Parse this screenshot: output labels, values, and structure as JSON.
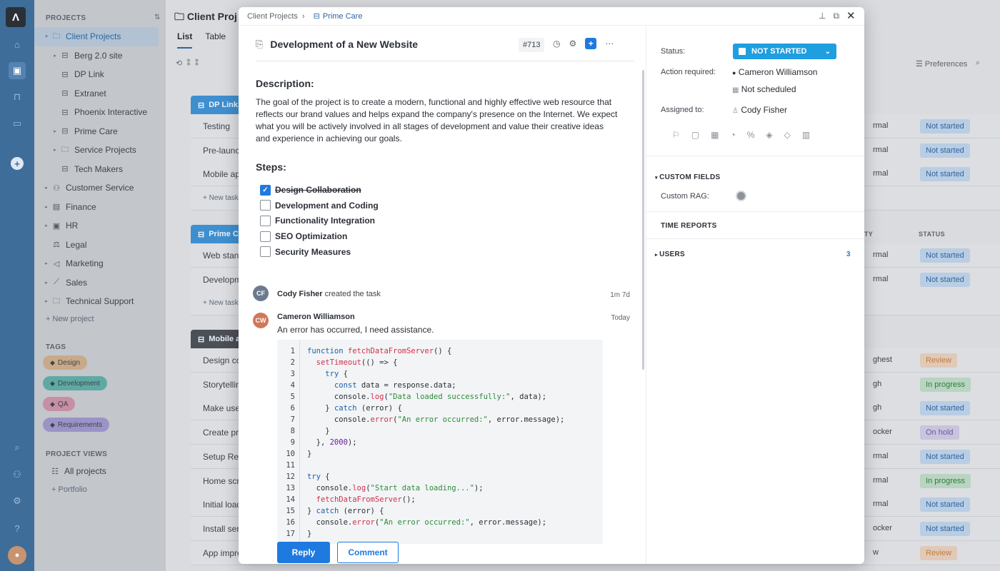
{
  "sidebar": {
    "heading": "PROJECTS",
    "tree": [
      {
        "label": "Client Projects",
        "icon": "folder-icon",
        "caret": "▾",
        "selected": true,
        "indent": 0
      },
      {
        "label": "Berg 2.0 site",
        "icon": "briefcase-icon",
        "caret": "▸",
        "indent": 1
      },
      {
        "label": "DP Link",
        "icon": "briefcase-icon",
        "caret": "",
        "indent": 1
      },
      {
        "label": "Extranet",
        "icon": "briefcase-icon",
        "caret": "",
        "indent": 1
      },
      {
        "label": "Phoenix Interactive",
        "icon": "briefcase-icon",
        "caret": "",
        "indent": 1
      },
      {
        "label": "Prime Care",
        "icon": "briefcase-icon",
        "caret": "▸",
        "indent": 1
      },
      {
        "label": "Service Projects",
        "icon": "folder-icon",
        "caret": "▸",
        "indent": 1
      },
      {
        "label": "Tech Makers",
        "icon": "briefcase-icon",
        "caret": "",
        "indent": 1
      },
      {
        "label": "Customer Service",
        "icon": "support-icon",
        "caret": "▸",
        "indent": 0
      },
      {
        "label": "Finance",
        "icon": "calculator-icon",
        "caret": "▸",
        "indent": 0
      },
      {
        "label": "HR",
        "icon": "id-card-icon",
        "caret": "▸",
        "indent": 0
      },
      {
        "label": "Legal",
        "icon": "legal-icon",
        "caret": "",
        "indent": 0
      },
      {
        "label": "Marketing",
        "icon": "megaphone-icon",
        "caret": "▸",
        "indent": 0
      },
      {
        "label": "Sales",
        "icon": "sales-icon",
        "caret": "▸",
        "indent": 0
      },
      {
        "label": "Technical Support",
        "icon": "folder-icon",
        "caret": "▸",
        "indent": 0
      }
    ],
    "new_project": "+ New project",
    "tags_heading": "TAGS",
    "tags": [
      {
        "label": "Design",
        "color": "#c9a98a"
      },
      {
        "label": "Development",
        "color": "#5fa9a3"
      },
      {
        "label": "QA",
        "color": "#c78fa3"
      },
      {
        "label": "Requirements",
        "color": "#9b93c8"
      }
    ],
    "views_heading": "PROJECT VIEWS",
    "all_projects": "All projects",
    "portfolio": "+ Portfolio"
  },
  "main": {
    "title": "Client Proj",
    "tabs": [
      "List",
      "Table"
    ],
    "preferences": "Preferences",
    "col_priority": "ITY",
    "col_status": "STATUS",
    "groups": [
      {
        "label": "DP Link",
        "color": "#3f8fcf"
      },
      {
        "label": "Prime C",
        "color": "#3f8fcf"
      },
      {
        "label": "Mobile a",
        "color": "#4b4f56"
      }
    ],
    "new_task": "+ New task",
    "rows_group1": [
      {
        "name": "Testing",
        "priority": "rmal",
        "status": "Not started",
        "status_color": "not"
      },
      {
        "name": "Pre-launch",
        "priority": "rmal",
        "status": "Not started",
        "status_color": "not"
      },
      {
        "name": "Mobile app",
        "priority": "rmal",
        "status": "Not started",
        "status_color": "not"
      }
    ],
    "rows_group2": [
      {
        "name": "Web stand",
        "priority": "rmal",
        "status": "Not started",
        "status_color": "not"
      },
      {
        "name": "Developm",
        "priority": "rmal",
        "status": "Not started",
        "status_color": "not"
      }
    ],
    "rows_group3": [
      {
        "name": "Design co",
        "priority": "ghest",
        "status": "Review",
        "status_color": "review"
      },
      {
        "name": "Storytellin",
        "priority": "gh",
        "status": "In progress",
        "status_color": "prog"
      },
      {
        "name": "Make use",
        "priority": "gh",
        "status": "Not started",
        "status_color": "not"
      },
      {
        "name": "Create pro",
        "priority": "ocker",
        "status": "On hold",
        "status_color": "hold"
      },
      {
        "name": "Setup Rea",
        "priority": "rmal",
        "status": "Not started",
        "status_color": "not"
      },
      {
        "name": "Home scr",
        "priority": "rmal",
        "status": "In progress",
        "status_color": "prog"
      },
      {
        "name": "Initial load",
        "priority": "rmal",
        "status": "Not started",
        "status_color": "not"
      },
      {
        "name": "Install ser",
        "priority": "ocker",
        "status": "Not started",
        "status_color": "not"
      },
      {
        "name": "App impro",
        "priority": "w",
        "status": "Review",
        "status_color": "review"
      }
    ]
  },
  "dialog": {
    "breadcrumb_root": "Client Projects",
    "breadcrumb_sep": "›",
    "breadcrumb_project": "Prime Care",
    "task_title": "Development of a New Website",
    "task_id": "#713",
    "description_heading": "Description:",
    "description": "The goal of the project is to create a modern, functional and highly effective web resource that reflects our brand values and helps expand the company's presence on the Internet. We expect what you will be actively involved in all stages of development and value their creative ideas and experience in achieving our goals.",
    "steps_heading": "Steps:",
    "steps": [
      {
        "label": "Design Collaboration",
        "done": true
      },
      {
        "label": "Development and Coding",
        "done": false
      },
      {
        "label": "Functionality Integration",
        "done": false
      },
      {
        "label": "SEO Optimization",
        "done": false
      },
      {
        "label": "Security Measures",
        "done": false
      }
    ],
    "activity": {
      "author": "Cody Fisher",
      "action": "created the task",
      "time": "1m 7d"
    },
    "comment": {
      "author": "Cameron Williamson",
      "time": "Today",
      "text": "An error has occurred, I need assistance.",
      "code_lines": [
        "function fetchDataFromServer() {",
        "  setTimeout(() => {",
        "    try {",
        "      const data = response.data;",
        "      console.log(\"Data loaded successfully:\", data);",
        "    } catch (error) {",
        "      console.error(\"An error occurred:\", error.message);",
        "    }",
        "  }, 2000);",
        "}",
        "",
        "try {",
        "  console.log(\"Start data loading...\");",
        "  fetchDataFromServer();",
        "} catch (error) {",
        "  console.error(\"An error occurred:\", error.message);",
        "}"
      ]
    },
    "reply_label": "Reply",
    "comment_label": "Comment",
    "right": {
      "status_label": "Status:",
      "status_value": "NOT STARTED",
      "action_label": "Action required:",
      "action_value": "Cameron Williamson",
      "schedule_value": "Not scheduled",
      "assigned_label": "Assigned to:",
      "assigned_value": "Cody Fisher",
      "custom_fields": "CUSTOM FIELDS",
      "custom_rag": "Custom RAG:",
      "time_reports": "TIME REPORTS",
      "users": "USERS",
      "users_count": "3"
    }
  },
  "colors": {
    "accent": "#1f7ae0",
    "status_blue": "#1f9ee0",
    "rail": "#3e6d9a"
  }
}
